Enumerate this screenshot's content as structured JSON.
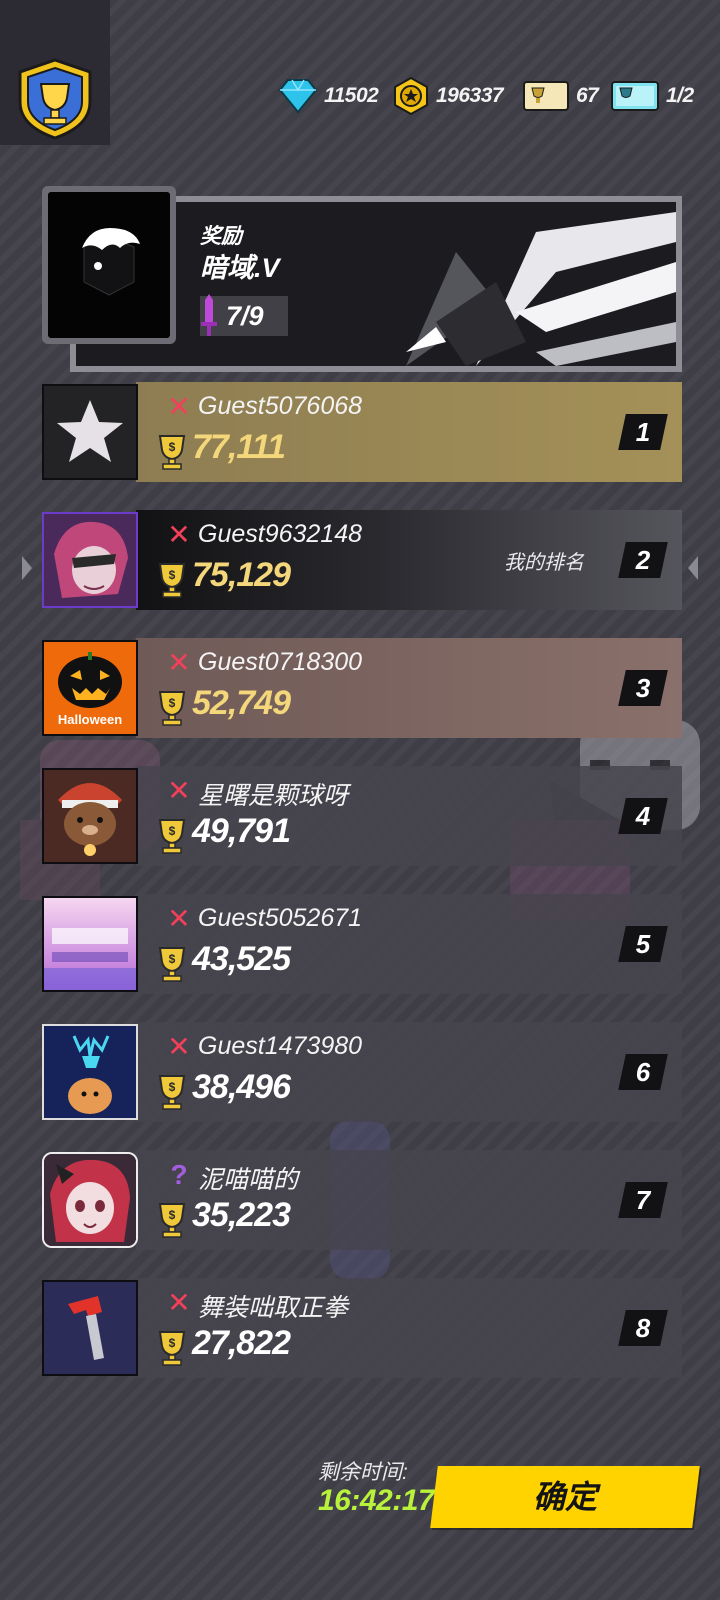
{
  "currencies": [
    {
      "icon": "diamond-icon",
      "value": "11502"
    },
    {
      "icon": "gold-coin-icon",
      "value": "196337"
    },
    {
      "icon": "ticket-icon",
      "value": "67"
    },
    {
      "icon": "event-ticket-icon",
      "value": "1/2"
    }
  ],
  "reward": {
    "label": "奖励",
    "name": "暗域.V",
    "progress": "7/9"
  },
  "leaderboard": [
    {
      "rank": "1",
      "name": "Guest5076068",
      "score": "77,111",
      "status_icon": "x-mark-icon",
      "avatar": "star-avatar",
      "is_me": false
    },
    {
      "rank": "2",
      "name": "Guest9632148",
      "score": "75,129",
      "status_icon": "x-mark-icon",
      "avatar": "girl-avatar",
      "is_me": true,
      "my_rank_label": "我的排名"
    },
    {
      "rank": "3",
      "name": "Guest0718300",
      "score": "52,749",
      "status_icon": "x-mark-icon",
      "avatar": "halloween-pumpkin-avatar",
      "avatar_text": "Halloween",
      "is_me": false
    },
    {
      "rank": "4",
      "name": "星曙是颗球呀",
      "score": "49,791",
      "status_icon": "x-mark-icon",
      "avatar": "bear-avatar",
      "is_me": false
    },
    {
      "rank": "5",
      "name": "Guest5052671",
      "score": "43,525",
      "status_icon": "x-mark-icon",
      "avatar": "anime-poster-avatar",
      "is_me": false
    },
    {
      "rank": "6",
      "name": "Guest1473980",
      "score": "38,496",
      "status_icon": "x-mark-icon",
      "avatar": "deer-avatar",
      "is_me": false
    },
    {
      "rank": "7",
      "name": "泥喵喵的",
      "score": "35,223",
      "status_icon": "question-mark-icon",
      "avatar": "redhair-girl-avatar",
      "is_me": false
    },
    {
      "rank": "8",
      "name": "舞装咄取正拳",
      "score": "27,822",
      "status_icon": "x-mark-icon",
      "avatar": "hammer-avatar",
      "is_me": false
    }
  ],
  "footer": {
    "time_label": "剩余时间:",
    "time_value": "16:42:17",
    "confirm_label": "确定"
  },
  "colors": {
    "gold_score": "#f4d77a",
    "my_score": "#f4d77a",
    "timer": "#b8f23a",
    "confirm": "#ffd300",
    "x_mark": "#f0405a",
    "question_mark": "#a35ee0"
  }
}
